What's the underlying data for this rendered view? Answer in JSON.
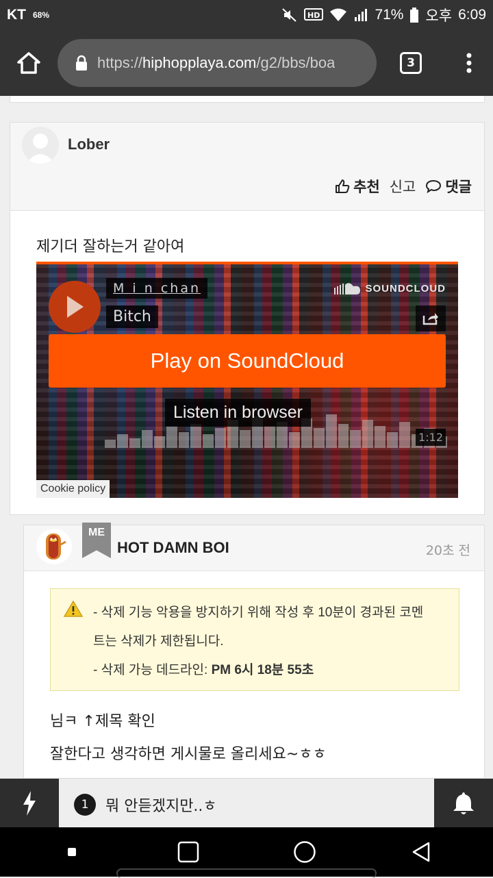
{
  "status_bar": {
    "carrier": "KT",
    "battery_mini": "68%",
    "battery": "71%",
    "ampm": "오후",
    "time": "6:09"
  },
  "browser": {
    "url_scheme": "https://",
    "url_host": "hiphopplaya.com",
    "url_path": "/g2/bbs/boa",
    "tab_count": "3"
  },
  "post": {
    "author": "Lober",
    "actions": {
      "recommend": "추천",
      "report": "신고",
      "comment": "댓글"
    },
    "text": "제기더 잘하는거 같아여"
  },
  "soundcloud": {
    "artist": "M i n chan",
    "track": "Bitch",
    "brand": "SOUNDCLOUD",
    "play_cta": "Play on SoundCloud",
    "listen": "Listen in browser",
    "duration": "1:12",
    "cookie": "Cookie policy",
    "accent": "#ff5500"
  },
  "comment": {
    "badge": "ME",
    "author": "HOT DAMN BOI",
    "time": "20초 전",
    "notice_line1": "- 삭제 기능 악용을 방지하기 위해 작성 후 10분이 경과된 코멘",
    "notice_line2": "트는 삭제가 제한됩니다.",
    "notice_line3_label": "- 삭제 가능 데드라인: ",
    "notice_line3_value": "PM 6시 18분 55초",
    "line1": "님ㅋ ↑제목 확인",
    "line2": "잘한다고 생각하면 게시물로 올리세요~ㅎㅎ"
  },
  "notification": {
    "count": "1",
    "text": "뭐 안듣겠지만..ㅎ"
  },
  "icons": {
    "home": "home-icon",
    "lock": "lock-icon",
    "menu": "more-vert-icon",
    "thumb": "thumb-up-icon",
    "chat": "chat-bubble-icon",
    "warning": "warning-icon",
    "bolt": "bolt-icon",
    "bell": "bell-icon"
  }
}
